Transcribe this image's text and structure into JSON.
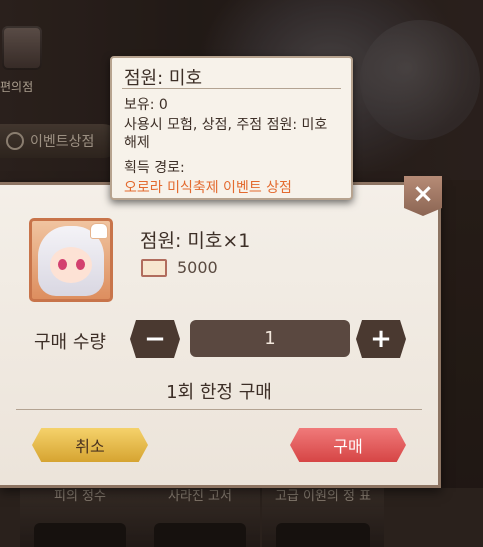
{
  "background": {
    "shop_label": "편의점",
    "event_tab_label": "이벤트상점",
    "bottom_tabs": [
      "피의 정수",
      "사라진 고서",
      "고급 이원의 정 표"
    ]
  },
  "dialog": {
    "item_name": "점원: 미호×1",
    "price_icon": "book-icon",
    "price": "5000",
    "quantity_label": "구매 수량",
    "quantity_value": "1",
    "minus_symbol": "−",
    "plus_symbol": "+",
    "limit_text": "1회 한정 구매",
    "cancel_label": "취소",
    "buy_label": "구매",
    "close_symbol": "×"
  },
  "tooltip": {
    "title": "점원: 미호",
    "owned": "보유: 0",
    "description": "사용시 모험, 상점, 주점 점원: 미호 해제",
    "source_label": "획득 경로:",
    "source_value": "오로라 미식축제 이벤트 상점"
  },
  "colors": {
    "accent_source": "#e36a2f",
    "buy_button": "#d64545",
    "cancel_button": "#d6a431"
  }
}
